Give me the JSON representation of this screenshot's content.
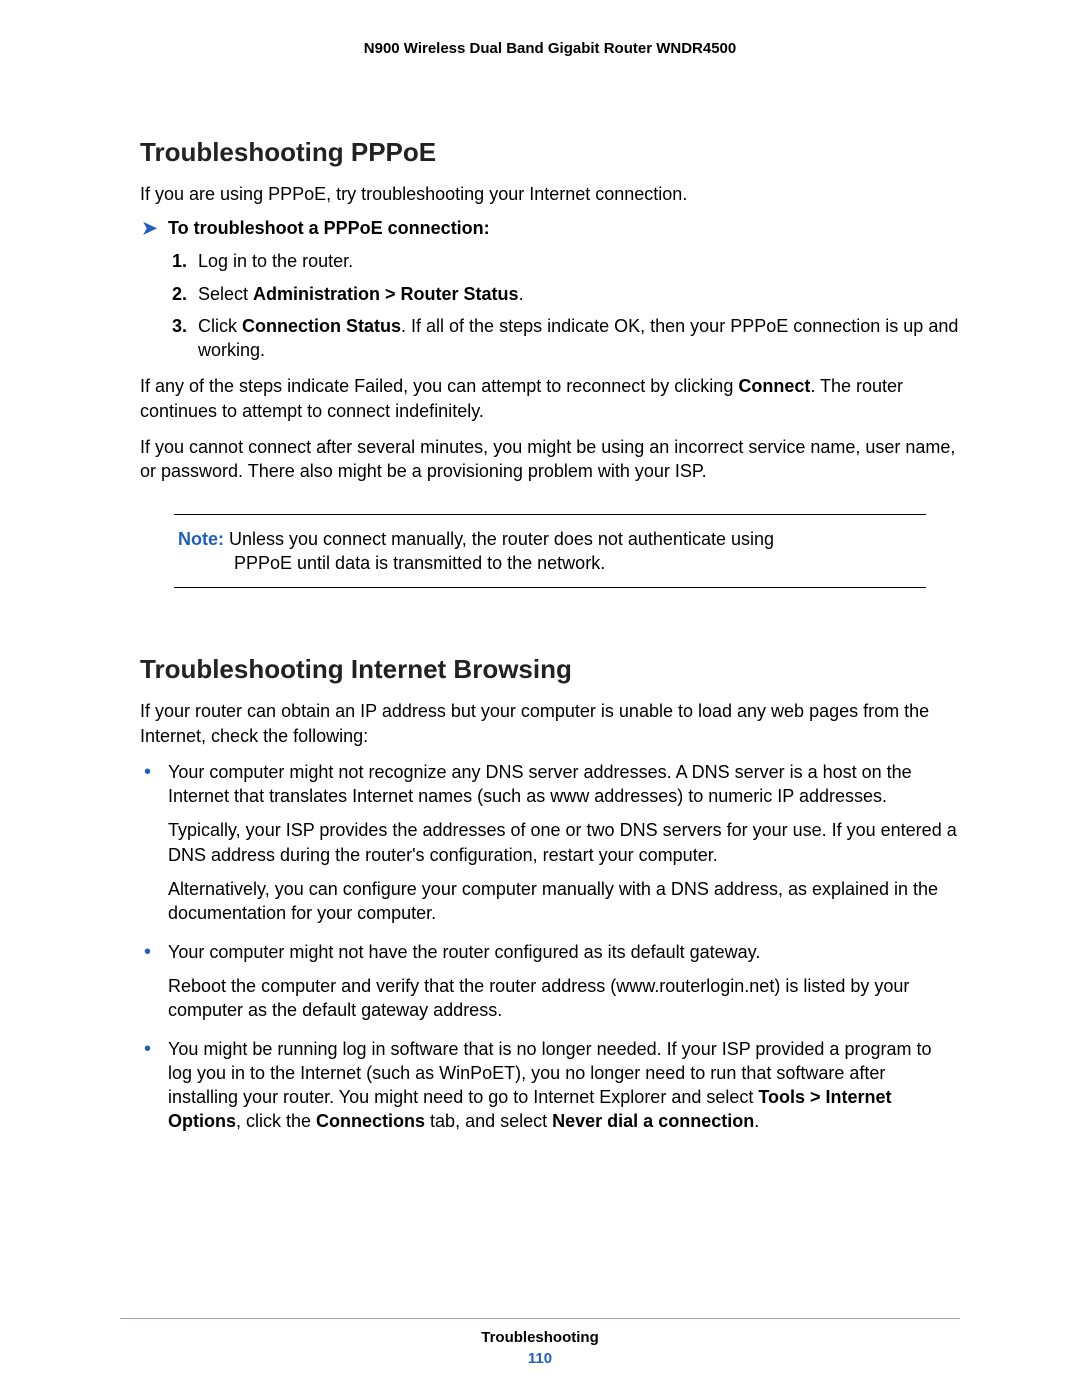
{
  "header": {
    "title": "N900 Wireless Dual Band Gigabit Router WNDR4500"
  },
  "section1": {
    "heading": "Troubleshooting PPPoE",
    "intro": "If you are using PPPoE, try troubleshooting your Internet connection.",
    "procHeading": "To troubleshoot a PPPoE connection:",
    "step1": "Log in to the router.",
    "step2_pre": "Select ",
    "step2_bold": "Administration > Router Status",
    "step2_post": ".",
    "step3_pre": "Click ",
    "step3_bold": "Connection Status",
    "step3_post": ". If all of the steps indicate OK, then your PPPoE connection is up and working.",
    "para1_pre": "If any of the steps indicate Failed, you can attempt to reconnect by clicking ",
    "para1_bold": "Connect",
    "para1_post": ". The router continues to attempt to connect indefinitely.",
    "para2": "If you cannot connect after several minutes, you might be using an incorrect service name, user name, or password. There also might be a provisioning problem with your ISP.",
    "note_label": "Note:",
    "note_line1": "  Unless you connect manually, the router does not authenticate using",
    "note_line2": "PPPoE until data is transmitted to the network."
  },
  "section2": {
    "heading": "Troubleshooting Internet Browsing",
    "intro": "If your router can obtain an IP address but your computer is unable to load any web pages from the Internet, check the following:",
    "b1_l1": "Your computer might not recognize any DNS server addresses. A DNS server is a host on the Internet that translates Internet names (such as www addresses) to numeric IP addresses.",
    "b1_p1": "Typically, your ISP provides the addresses of one or two DNS servers for your use. If you entered a DNS address during the router's configuration, restart your computer.",
    "b1_p2": "Alternatively, you can configure your computer manually with a DNS address, as explained in the documentation for your computer.",
    "b2_l1": "Your computer might not have the router configured as its default gateway.",
    "b2_p1": "Reboot the computer and verify that the router address (www.routerlogin.net) is listed by your computer as the default gateway address.",
    "b3_pre": "You might be running log in software that is no longer needed. If your ISP provided a program to log you in to the Internet (such as WinPoET), you no longer need to run that software after installing your router. You might need to go to Internet Explorer and select ",
    "b3_bold1": "Tools > Internet Options",
    "b3_mid1": ", click the ",
    "b3_bold2": "Connections",
    "b3_mid2": " tab, and select ",
    "b3_bold3": "Never dial a connection",
    "b3_post": "."
  },
  "footer": {
    "title": "Troubleshooting",
    "page": "110"
  }
}
